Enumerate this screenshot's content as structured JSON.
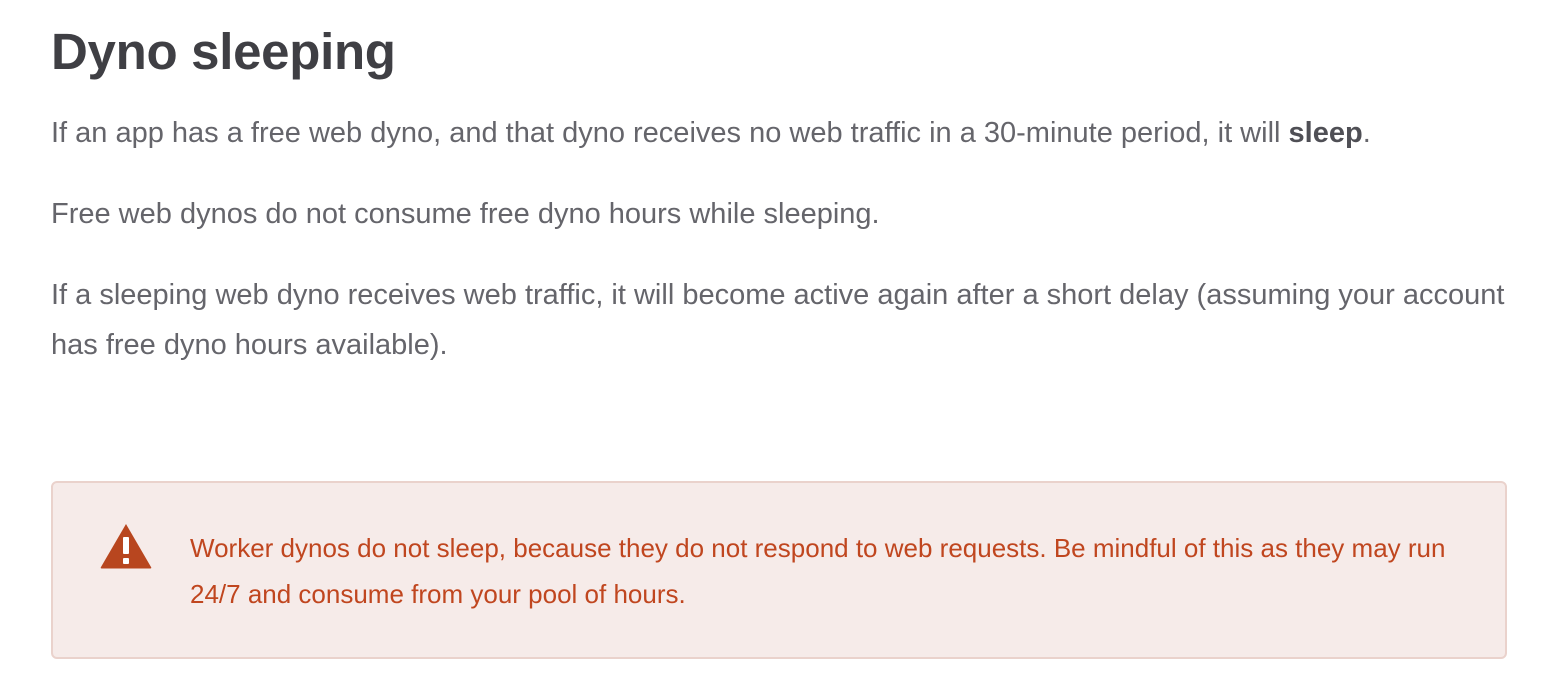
{
  "article": {
    "heading": "Dyno sleeping",
    "paragraphs": {
      "p1_before": "If an app has a free web dyno, and that dyno receives no web traffic in a 30-minute period, it will ",
      "p1_strong": "sleep",
      "p1_after": ".",
      "p2": "Free web dynos do not consume free dyno hours while sleeping.",
      "p3": "If a sleeping web dyno receives web traffic, it will become active again after a short delay (assuming your account has free dyno hours available)."
    },
    "warning": {
      "icon": "warning-triangle-icon",
      "text": "Worker dynos do not sleep, because they do not respond to web requests. Be mindful of this as they may run 24/7 and consume from your pool of hours."
    }
  },
  "colors": {
    "heading": "#3f3f44",
    "body_text": "#65656b",
    "warning_text": "#c0461f",
    "warning_background": "#f6ebe9",
    "warning_border": "#ead2cc",
    "warning_icon": "#b8461f"
  }
}
